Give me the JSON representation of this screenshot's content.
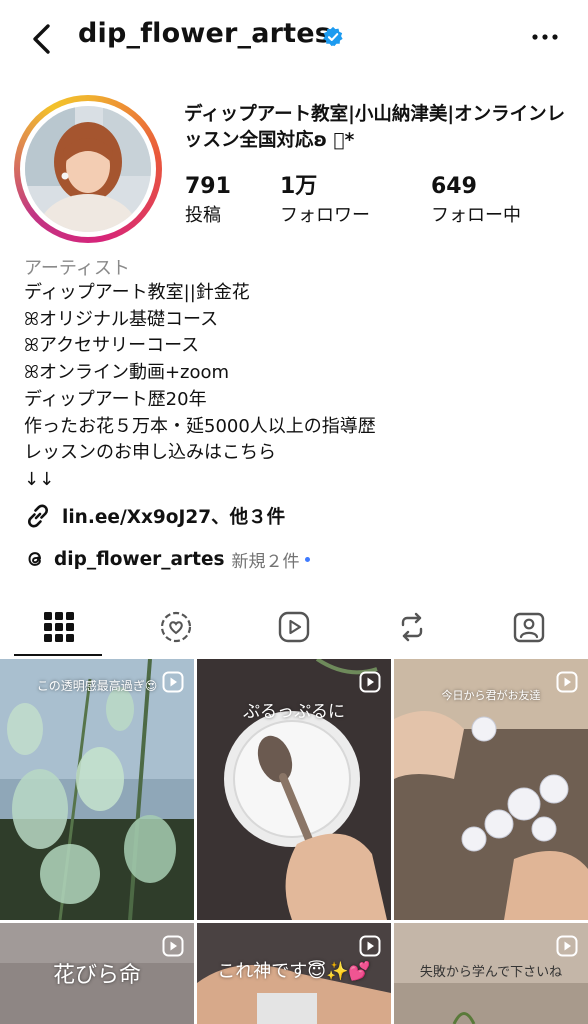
{
  "header": {
    "username": "dip_flower_artes"
  },
  "profile": {
    "display_name": "ディップアート教室|小山納津美|オンラインレッスン全国対応ʚ ゚*",
    "stats": [
      {
        "value": "791",
        "label": "投稿"
      },
      {
        "value": "1万",
        "label": "フォロワー"
      },
      {
        "value": "649",
        "label": "フォロー中"
      }
    ],
    "category": "アーティスト",
    "bio": [
      "ディップアート教室||針金花",
      "ꕤオリジナル基礎コース",
      "ꕤアクセサリーコース",
      "ꕤオンライン動画+zoom",
      "ディップアート歴20年",
      "作ったお花５万本・延5000人以上の指導歴",
      "レッスンのお申し込みはこちら",
      "↓↓"
    ],
    "link_text": "lin.ee/Xx9oJ27、他３件",
    "threads_name": "dip_flower_artes",
    "threads_new": "新規２件"
  },
  "tabs": [
    {
      "icon": "grid-icon",
      "active": true
    },
    {
      "icon": "heart-circle-icon",
      "active": false
    },
    {
      "icon": "reels-icon",
      "active": false
    },
    {
      "icon": "repost-icon",
      "active": false
    },
    {
      "icon": "tagged-icon",
      "active": false
    }
  ],
  "posts": [
    {
      "caption": "この透明感最高過ぎ😍",
      "type": "reel"
    },
    {
      "caption": "ぷるっぷるに",
      "type": "reel"
    },
    {
      "caption": "今日から君がお友達",
      "type": "reel"
    },
    {
      "caption": "花びら命",
      "type": "reel"
    },
    {
      "caption": "これ神です😇✨💕",
      "type": "reel"
    },
    {
      "caption": "失敗から学んで下さいね",
      "type": "reel"
    }
  ],
  "colors": {
    "verified": "#1d9bf0",
    "muted": "#737373",
    "threads_dot": "#3f7bff"
  }
}
